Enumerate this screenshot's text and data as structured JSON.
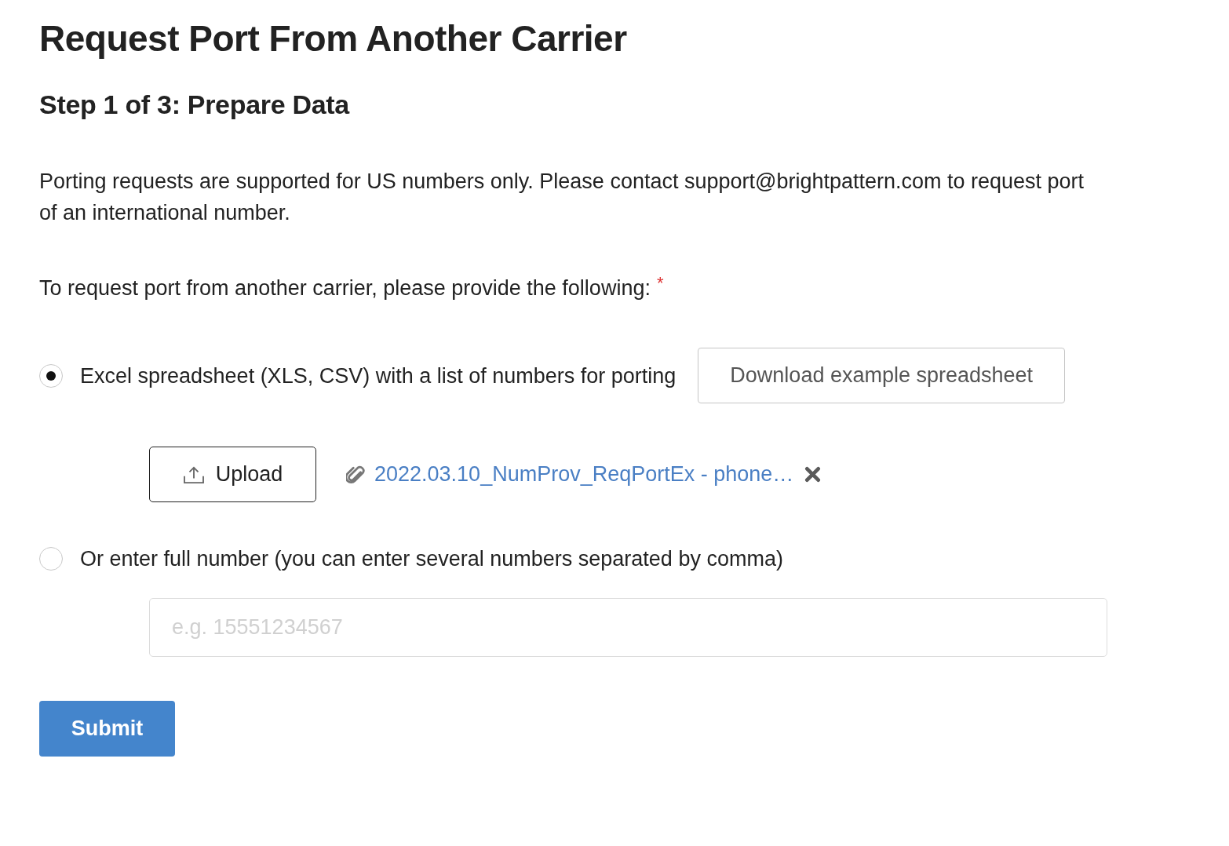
{
  "title": "Request Port From Another Carrier",
  "step_heading": "Step 1 of 3: Prepare Data",
  "notice": "Porting requests are supported for US numbers only. Please contact support@brightpattern.com to request port of an international number.",
  "prompt": {
    "text": "To request port from another carrier, please provide the following:",
    "required_mark": "*"
  },
  "options": [
    {
      "kind": "file",
      "label": "Excel spreadsheet (XLS, CSV) with a list of numbers for porting",
      "selected": true,
      "download_button": "Download example spreadsheet",
      "upload_button": "Upload",
      "file_name": "2022.03.10_NumProv_ReqPortEx - phone…"
    },
    {
      "kind": "text",
      "label": "Or enter full number (you can enter several numbers separated by comma)",
      "selected": false,
      "placeholder": "e.g. 15551234567"
    }
  ],
  "submit_button": "Submit"
}
